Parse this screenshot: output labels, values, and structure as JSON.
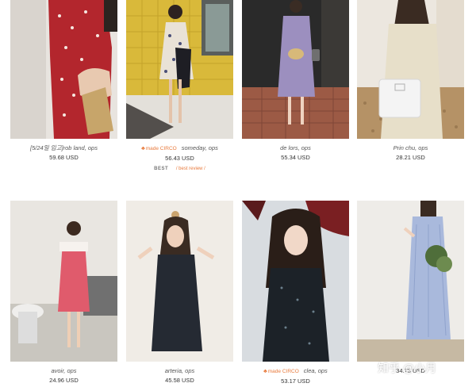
{
  "products": [
    {
      "name": "[5/24일 입고]rob land, ops",
      "price": "59.68 USD",
      "brand": "",
      "badge_best": "",
      "badge_review": ""
    },
    {
      "name": "someday, ops",
      "price": "56.43 USD",
      "brand": "made CIRCO",
      "badge_best": "BEST",
      "badge_review": "/ best review /"
    },
    {
      "name": "de lors, ops",
      "price": "55.34 USD",
      "brand": "",
      "badge_best": "",
      "badge_review": ""
    },
    {
      "name": "Prin chu, ops",
      "price": "28.21 USD",
      "brand": "",
      "badge_best": "",
      "badge_review": ""
    },
    {
      "name": "avoir, ops",
      "price": "24.96 USD",
      "brand": "",
      "badge_best": "",
      "badge_review": ""
    },
    {
      "name": "arteria, ops",
      "price": "45.58 USD",
      "brand": "",
      "badge_best": "",
      "badge_review": ""
    },
    {
      "name": "clea, ops",
      "price": "53.17 USD",
      "brand": "made CIRCO",
      "badge_best": "",
      "badge_review": ""
    },
    {
      "name": "",
      "price": "34.73 USD",
      "brand": "",
      "badge_best": "",
      "badge_review": ""
    }
  ],
  "watermark": "知乎 @小月"
}
